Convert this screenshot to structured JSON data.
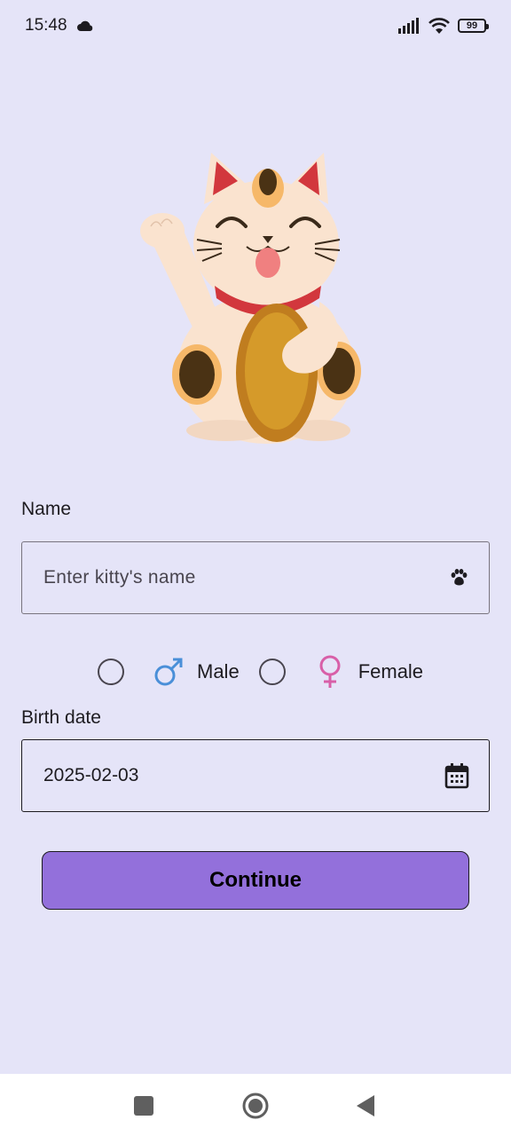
{
  "status_bar": {
    "time": "15:48",
    "weather_icon": "cloud-icon",
    "signal_icon": "signal-icon",
    "wifi_icon": "wifi-icon",
    "battery_level": "99"
  },
  "illustration": {
    "name": "lucky-cat",
    "colors": {
      "body": "#fae3cf",
      "coin": "#d59a2a",
      "collar": "#d2373d",
      "ear": "#d2373d",
      "spot": "#4a3214"
    }
  },
  "form": {
    "name_label": "Name",
    "name_placeholder": "Enter kitty's name",
    "name_icon": "paw-icon",
    "gender": {
      "male_label": "Male",
      "female_label": "Female",
      "male_color": "#4a8fd8",
      "female_color": "#d85fa8"
    },
    "birth_label": "Birth date",
    "birth_value": "2025-02-03",
    "birth_icon": "calendar-icon",
    "continue_label": "Continue"
  },
  "colors": {
    "background": "#e5e4f8",
    "accent": "#9370db",
    "nav_bar": "#ffffff"
  },
  "nav_bar": {
    "recents": "square-icon",
    "home": "circle-icon",
    "back": "triangle-back-icon"
  }
}
